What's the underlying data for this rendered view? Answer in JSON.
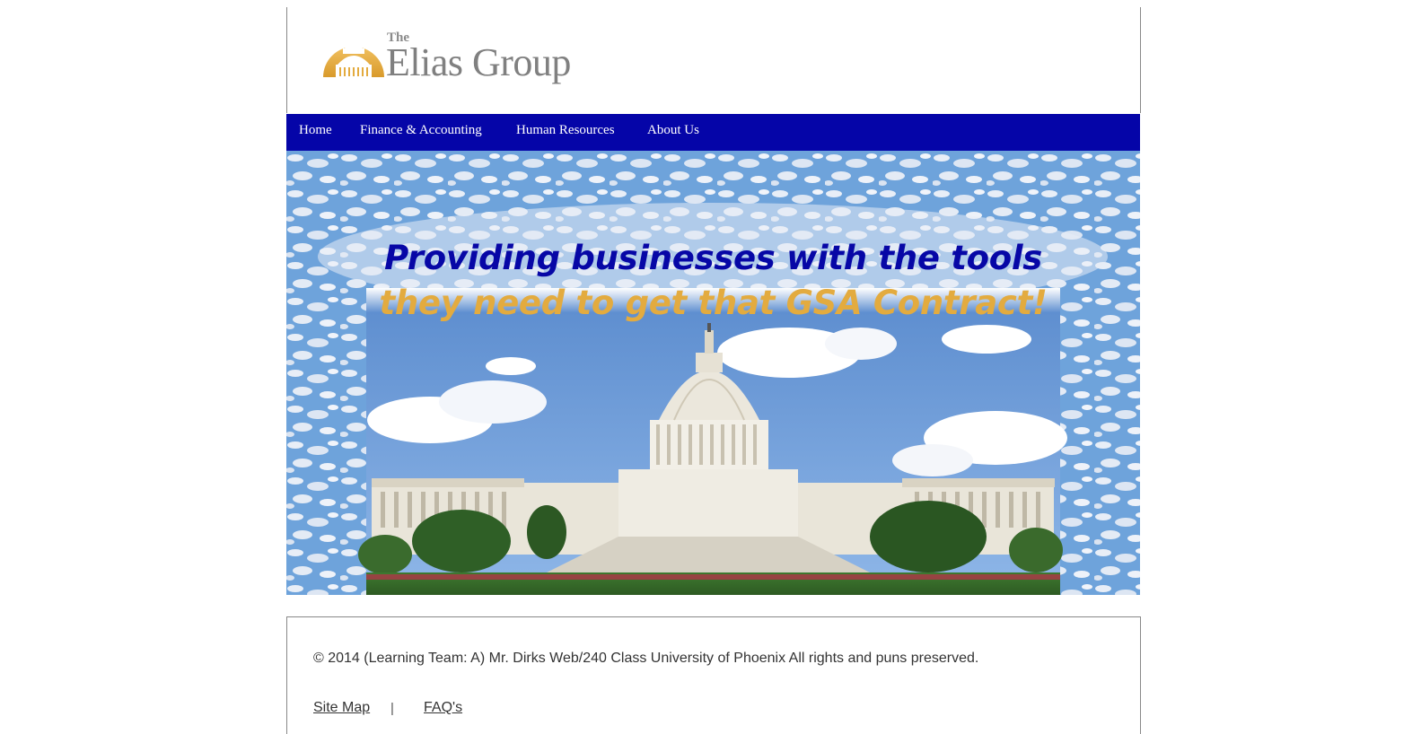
{
  "logo": {
    "the": "The",
    "name": "Elias Group",
    "dome_color": "#e3ab3f"
  },
  "nav": {
    "items": [
      {
        "label": "Home"
      },
      {
        "label": "Finance & Accounting"
      },
      {
        "label": "Human Resources"
      },
      {
        "label": "About Us"
      }
    ],
    "background": "#0505a8"
  },
  "hero": {
    "line1": "Providing businesses with the tools",
    "line2": "they need to get that GSA Contract!",
    "line1_color": "#0707a6",
    "line2_color": "#e3ab3f",
    "image": "us-capitol-photo"
  },
  "footer": {
    "copyright": "© 2014 (Learning Team: A) Mr. Dirks Web/240 Class University of Phoenix All rights and puns preserved.",
    "links": [
      {
        "label": "Site Map"
      },
      {
        "label": "FAQ's"
      }
    ],
    "separator": "|"
  }
}
